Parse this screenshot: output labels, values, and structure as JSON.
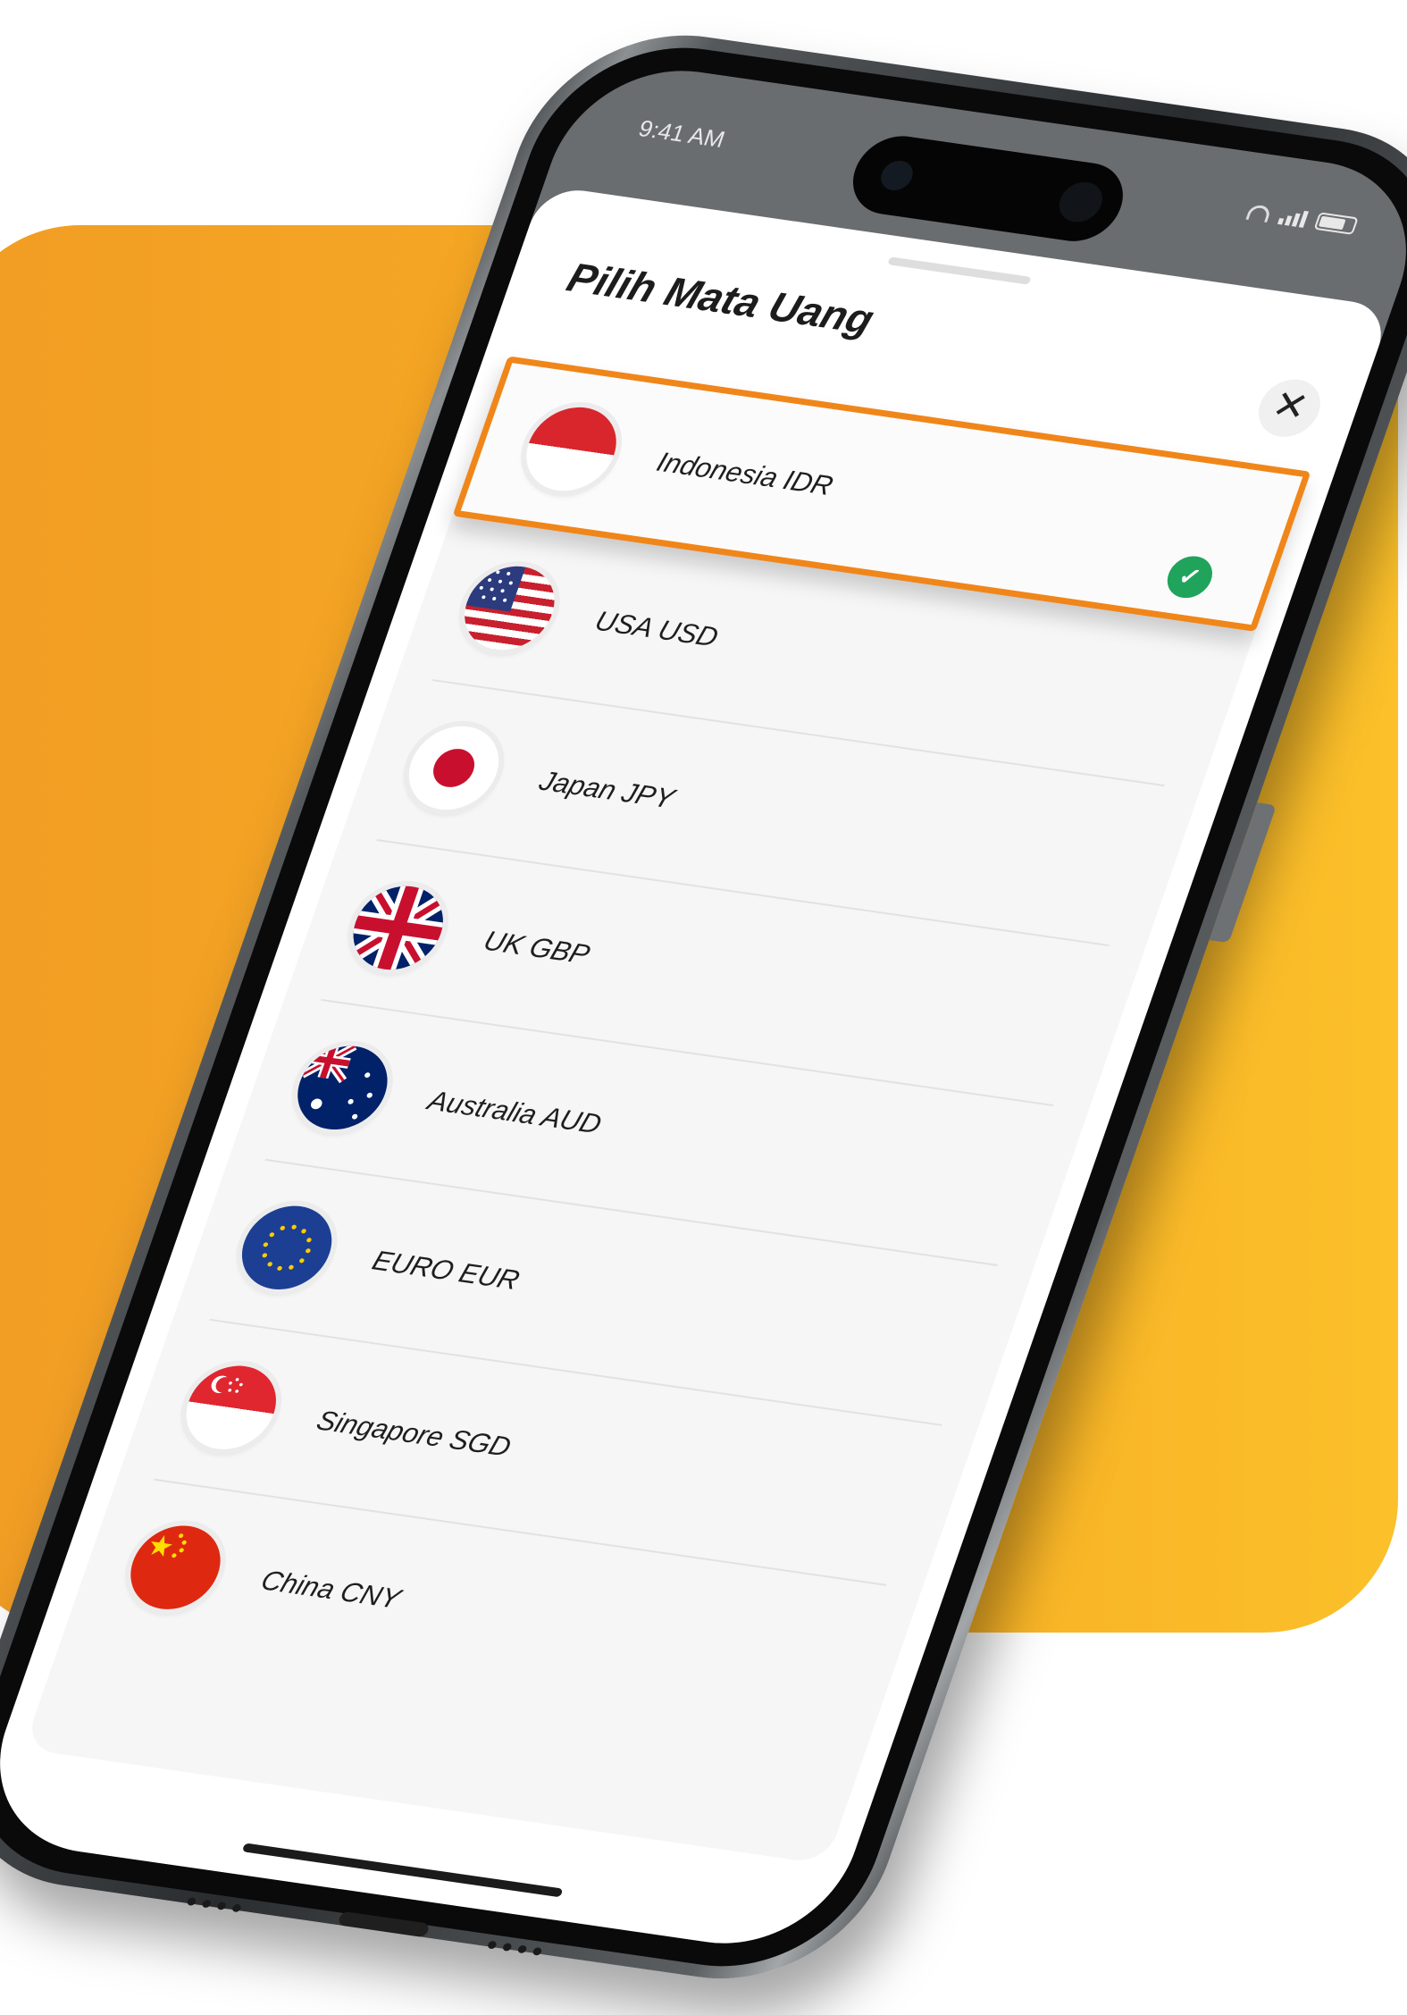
{
  "status_bar": {
    "time": "9:41 AM"
  },
  "sheet": {
    "title": "Pilih Mata Uang",
    "close_label": "✕"
  },
  "currencies": [
    {
      "label": "Indonesia IDR",
      "flag": "indonesia-flag-icon",
      "selected": true
    },
    {
      "label": "USA USD",
      "flag": "usa-flag-icon",
      "selected": false
    },
    {
      "label": "Japan JPY",
      "flag": "japan-flag-icon",
      "selected": false
    },
    {
      "label": "UK GBP",
      "flag": "uk-flag-icon",
      "selected": false
    },
    {
      "label": "Australia AUD",
      "flag": "australia-flag-icon",
      "selected": false
    },
    {
      "label": "EURO EUR",
      "flag": "eu-flag-icon",
      "selected": false
    },
    {
      "label": "Singapore SGD",
      "flag": "singapore-flag-icon",
      "selected": false
    },
    {
      "label": "China CNY",
      "flag": "china-flag-icon",
      "selected": false
    }
  ],
  "colors": {
    "accent": "#f08619",
    "check": "#20a45b",
    "background": "#f6a823"
  },
  "check_icon": "✓"
}
